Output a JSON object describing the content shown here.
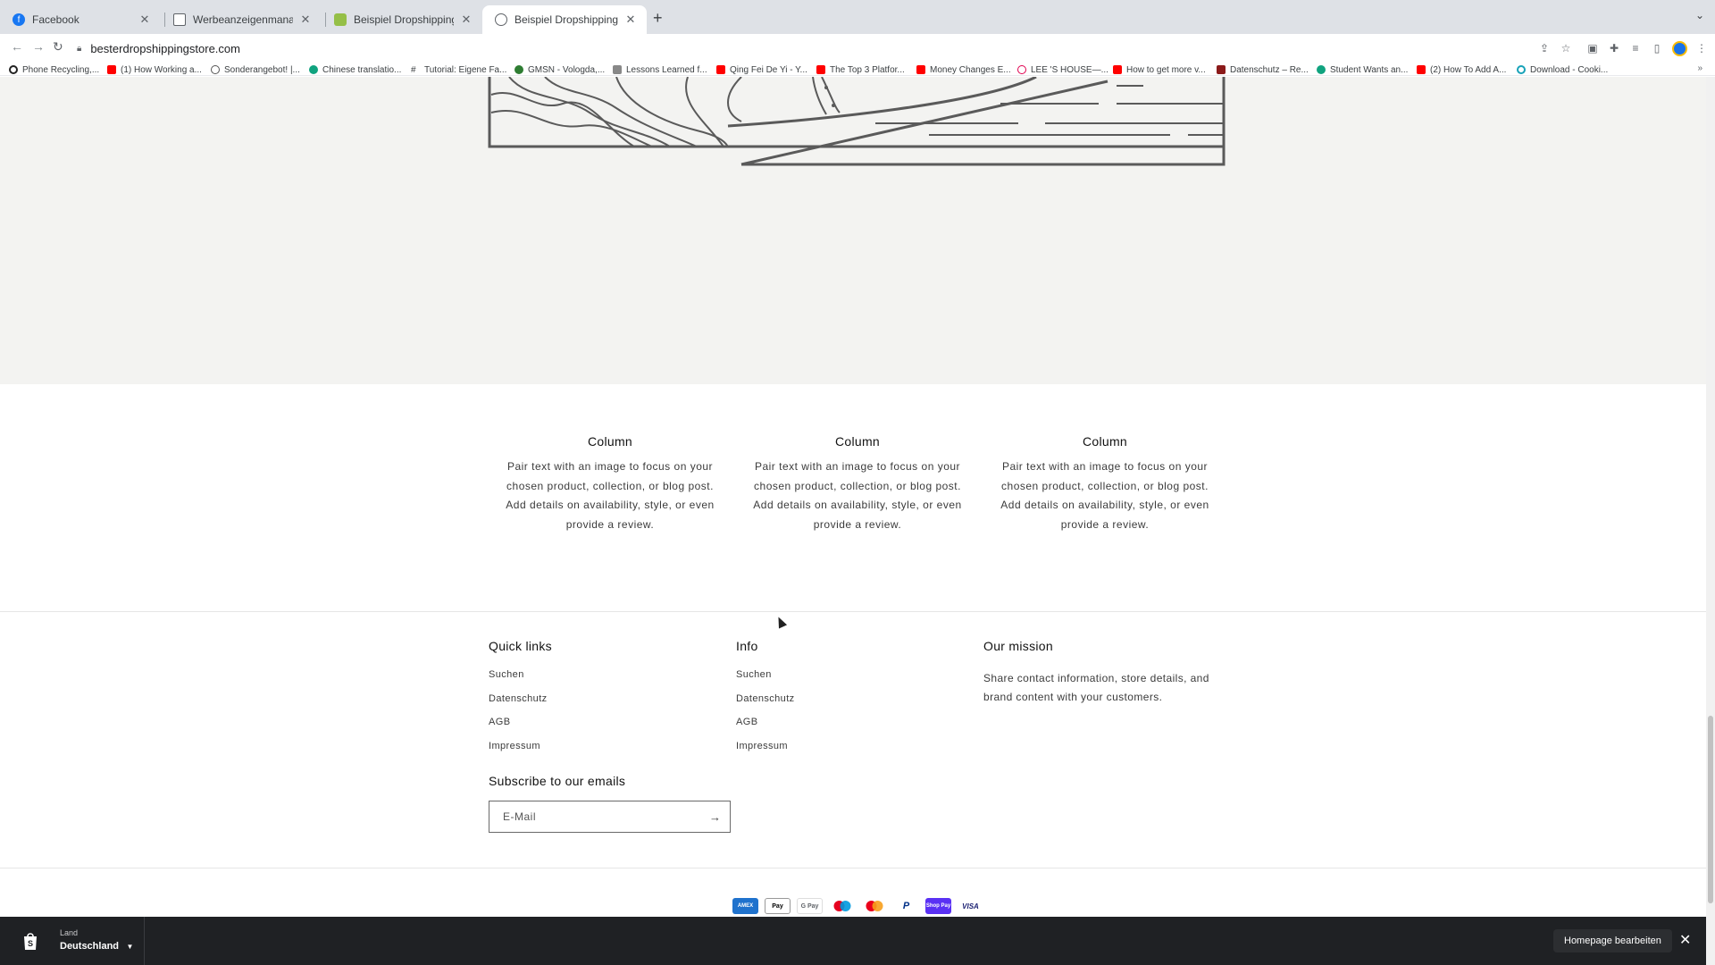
{
  "browser": {
    "tabs": [
      {
        "title": "Facebook",
        "active": false
      },
      {
        "title": "Werbeanzeigenmanager - Werb",
        "active": false
      },
      {
        "title": "Beispiel Dropshipping Store - T",
        "active": false
      },
      {
        "title": "Beispiel Dropshipping Store",
        "active": true
      }
    ],
    "url": "besterdropshippingstore.com",
    "bookmarks": [
      "Phone Recycling,...",
      "(1) How Working a...",
      "Sonderangebot! |...",
      "Chinese translatio...",
      "Tutorial: Eigene Fa...",
      "GMSN - Vologda,...",
      "Lessons Learned f...",
      "Qing Fei De Yi - Y...",
      "The Top 3 Platfor...",
      "Money Changes E...",
      "LEE 'S HOUSE—...",
      "How to get more v...",
      "Datenschutz – Re...",
      "Student Wants an...",
      "(2) How To Add A...",
      "Download - Cooki..."
    ]
  },
  "multicolumn": {
    "columns": [
      {
        "heading": "Column",
        "text": "Pair text with an image to focus on your chosen product, collection, or blog post. Add details on availability, style, or even provide a review."
      },
      {
        "heading": "Column",
        "text": "Pair text with an image to focus on your chosen product, collection, or blog post. Add details on availability, style, or even provide a review."
      },
      {
        "heading": "Column",
        "text": "Pair text with an image to focus on your chosen product, collection, or blog post. Add details on availability, style, or even provide a review."
      }
    ]
  },
  "footer": {
    "quick_links": {
      "heading": "Quick links",
      "links": [
        "Suchen",
        "Datenschutz",
        "AGB",
        "Impressum"
      ]
    },
    "info": {
      "heading": "Info",
      "links": [
        "Suchen",
        "Datenschutz",
        "AGB",
        "Impressum"
      ]
    },
    "mission": {
      "heading": "Our mission",
      "text": "Share contact information, store details, and brand content with your customers."
    },
    "newsletter": {
      "heading": "Subscribe to our emails",
      "placeholder": "E-Mail"
    },
    "payments": [
      "AMEX",
      "Pay",
      "G Pay",
      "Maestro",
      "Mastercard",
      "P",
      "Shop Pay",
      "VISA"
    ]
  },
  "shopify_bar": {
    "country_label": "Land",
    "country_value": "Deutschland",
    "edit_button": "Homepage bearbeiten"
  }
}
